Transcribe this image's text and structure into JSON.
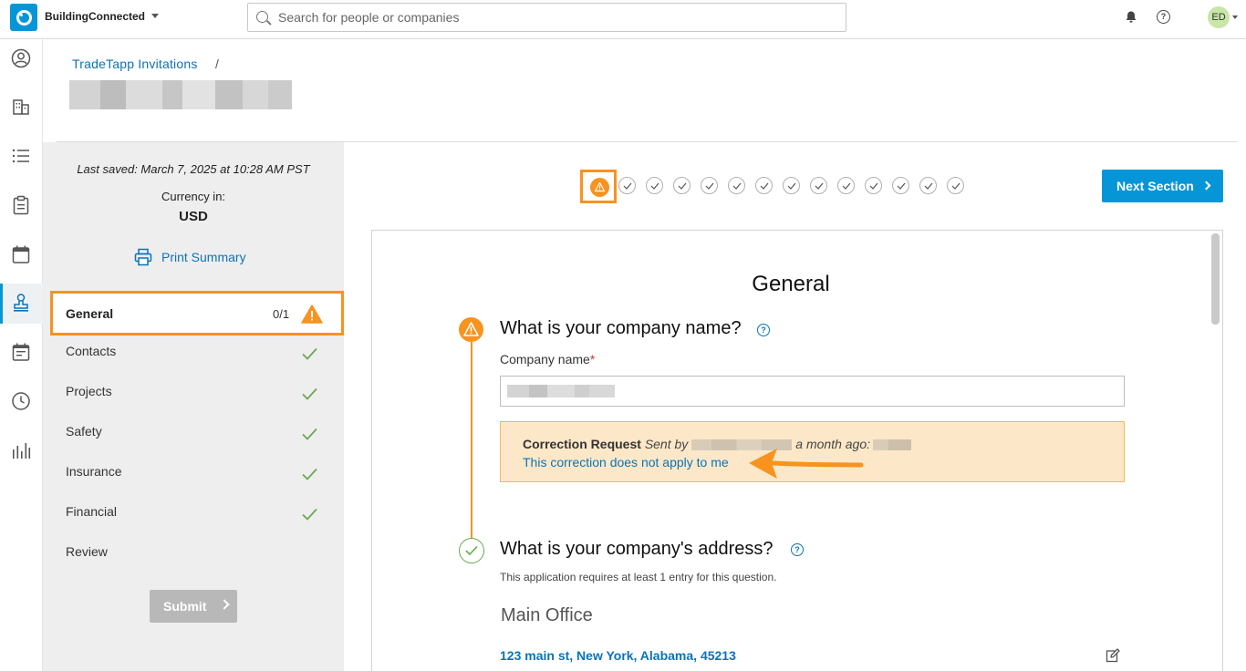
{
  "topbar": {
    "brand": "BuildingConnected",
    "search_placeholder": "Search for people or companies",
    "avatar_initials": "ED"
  },
  "rail": {
    "icons": [
      "profile-icon",
      "buildings-icon",
      "list-icon",
      "clipboard-icon",
      "calendar-icon",
      "stamp-icon",
      "calendar-check-icon",
      "clock-icon",
      "analytics-icon"
    ],
    "active": "stamp-icon"
  },
  "header": {
    "breadcrumb": "TradeTapp Invitations",
    "separator": "/"
  },
  "sidebar": {
    "last_saved": "Last saved: March 7, 2025 at 10:28 AM PST",
    "currency_label": "Currency in:",
    "currency_value": "USD",
    "print_label": "Print Summary",
    "general": {
      "label": "General",
      "count": "0/1"
    },
    "items": [
      {
        "label": "Contacts",
        "complete": true
      },
      {
        "label": "Projects",
        "complete": true
      },
      {
        "label": "Safety",
        "complete": true
      },
      {
        "label": "Insurance",
        "complete": true
      },
      {
        "label": "Financial",
        "complete": true
      },
      {
        "label": "Review",
        "complete": false
      }
    ],
    "submit_label": "Submit"
  },
  "steps": {
    "warning_count": 1,
    "complete_count": 13
  },
  "next_section_label": "Next Section",
  "form": {
    "section_title": "General",
    "q1": {
      "title": "What is your company name?",
      "field_label": "Company name",
      "required_mark": "*"
    },
    "correction": {
      "heading": "Correction Request",
      "sent_by": "Sent by",
      "time": "a month ago:",
      "link": "This correction does not apply to me"
    },
    "q2": {
      "title": "What is your company's address?",
      "subtitle": "This application requires at least 1 entry for this question.",
      "office_heading": "Main Office",
      "address": "123 main st, New York, Alabama, 45213"
    }
  },
  "colors": {
    "accent_blue": "#0696d7",
    "link_blue": "#0b73b8",
    "warning_orange": "#f7931e",
    "success_green": "#6aa84f",
    "correction_bg": "#fce8c8"
  }
}
